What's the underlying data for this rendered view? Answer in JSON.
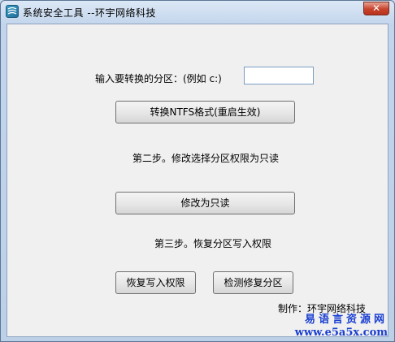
{
  "window": {
    "title": "系统安全工具  --环宇网络科技",
    "close_glyph": "✕"
  },
  "main": {
    "partition_label": "输入要转换的分区：(例如 c:)",
    "partition_input_value": "",
    "convert_button": "转换NTFS格式(重启生效)",
    "step2_label": "第二步。修改选择分区权限为只读",
    "readonly_button": "修改为只读",
    "step3_label": "第三步。恢复分区写入权限",
    "restore_button": "恢复写入权限",
    "repair_button": "检测修复分区",
    "credit_label": "制作：环宇网络科技"
  },
  "watermark": {
    "site_name": "易语言资源网",
    "url": "www.e5a5x.com"
  }
}
